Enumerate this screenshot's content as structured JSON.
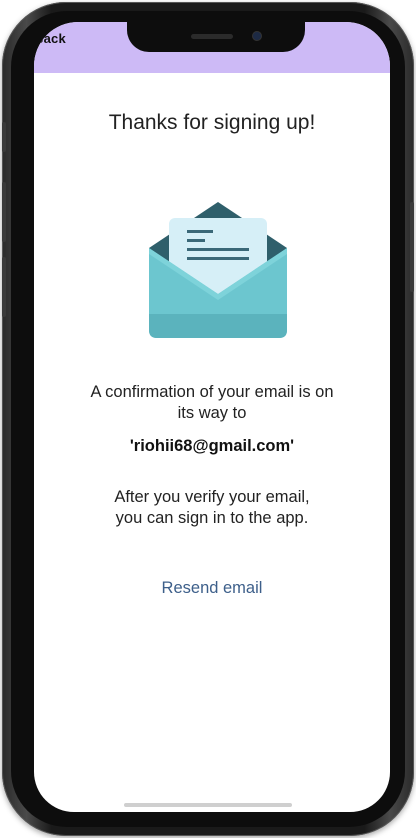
{
  "header": {
    "back_label": "Back",
    "background_color": "#cdbaf6"
  },
  "main": {
    "title": "Thanks for signing up!",
    "illustration": "open-envelope-with-letter",
    "confirmation_line1": "A confirmation of your email is on",
    "confirmation_line2": "its way to",
    "email": "'riohii68@gmail.com'",
    "verify_line1": "After you verify your email,",
    "verify_line2": "you can sign in to the app.",
    "resend_label": "Resend email",
    "link_color": "#3d5f8a"
  }
}
